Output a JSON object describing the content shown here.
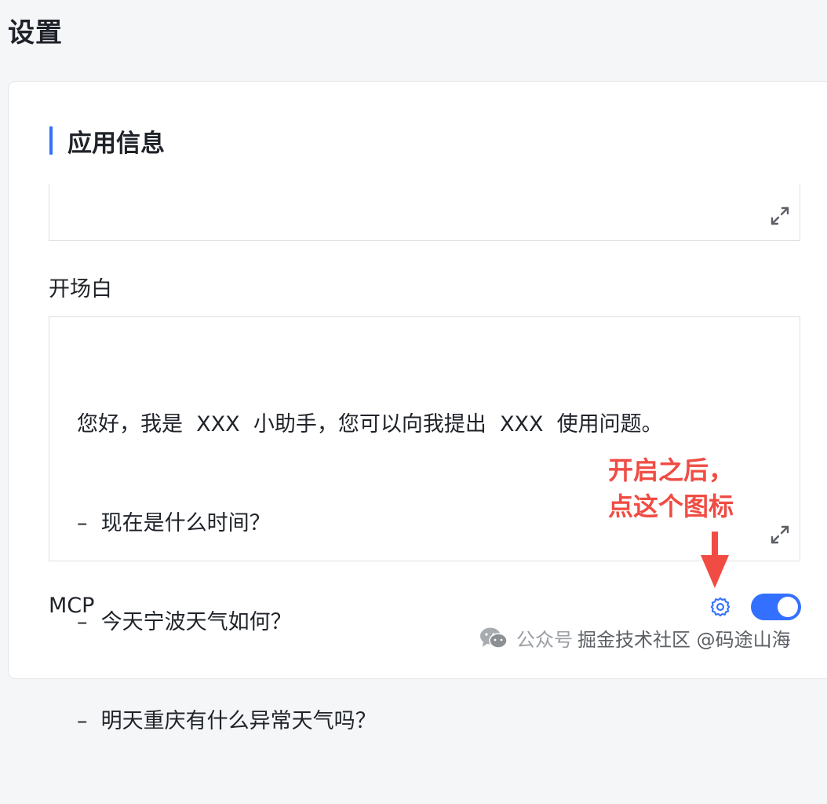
{
  "page": {
    "title": "设置"
  },
  "section": {
    "title": "应用信息"
  },
  "opening": {
    "label": "开场白",
    "lines": [
      "您好，我是  XXX  小助手，您可以向我提出  XXX  使用问题。",
      "–  现在是什么时间？",
      "–  今天宁波天气如何？",
      "–  明天重庆有什么异常天气吗？"
    ]
  },
  "annotation": {
    "line1": "开启之后，",
    "line2": "点这个图标",
    "color": "#f04c44"
  },
  "mcp": {
    "label": "MCP",
    "enabled": true
  },
  "watermark": {
    "wechat": "公众号",
    "text": "掘金技术社区 @码途山海"
  },
  "colors": {
    "accent": "#3370ff",
    "annotation": "#f04c44"
  },
  "icons": {
    "expand": "expand-icon",
    "settings": "gear-icon",
    "wechat": "wechat-icon"
  }
}
